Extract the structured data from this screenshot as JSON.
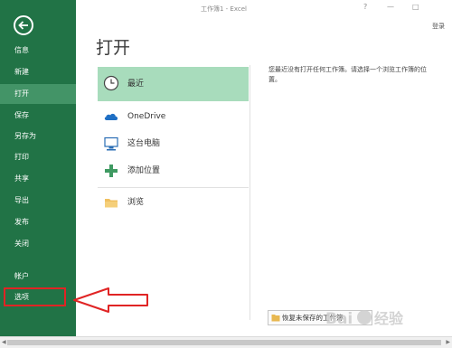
{
  "window": {
    "title": "工作簿1 - Excel",
    "help": "?",
    "minimize": "—",
    "maximize": "□",
    "signin": "登录"
  },
  "sidebar": {
    "items": [
      {
        "label": "信息",
        "active": false
      },
      {
        "label": "新建",
        "active": false
      },
      {
        "label": "打开",
        "active": true
      },
      {
        "label": "保存",
        "active": false
      },
      {
        "label": "另存为",
        "active": false
      },
      {
        "label": "打印",
        "active": false
      },
      {
        "label": "共享",
        "active": false
      },
      {
        "label": "导出",
        "active": false
      },
      {
        "label": "发布",
        "active": false
      },
      {
        "label": "关闭",
        "active": false
      }
    ],
    "bottom_items": [
      {
        "label": "帐户"
      },
      {
        "label": "选项"
      }
    ]
  },
  "main": {
    "title": "打开",
    "locations": [
      {
        "label": "最近",
        "icon": "clock-icon",
        "active": true
      },
      {
        "label": "OneDrive",
        "icon": "cloud-icon",
        "active": false
      },
      {
        "label": "这台电脑",
        "icon": "computer-icon",
        "active": false
      },
      {
        "label": "添加位置",
        "icon": "plus-icon",
        "active": false
      },
      {
        "label": "浏览",
        "icon": "folder-icon",
        "active": false
      }
    ],
    "recent_message": "您最近没有打开任何工作簿。请选择一个浏览工作簿的位置。",
    "recover_button": "恢复未保存的工作簿"
  },
  "colors": {
    "sidebar": "#217346",
    "sidebar_active": "#439467",
    "location_active": "#a8dcbc",
    "annotation_red": "#e02424"
  },
  "watermark": "Baidu 经验"
}
